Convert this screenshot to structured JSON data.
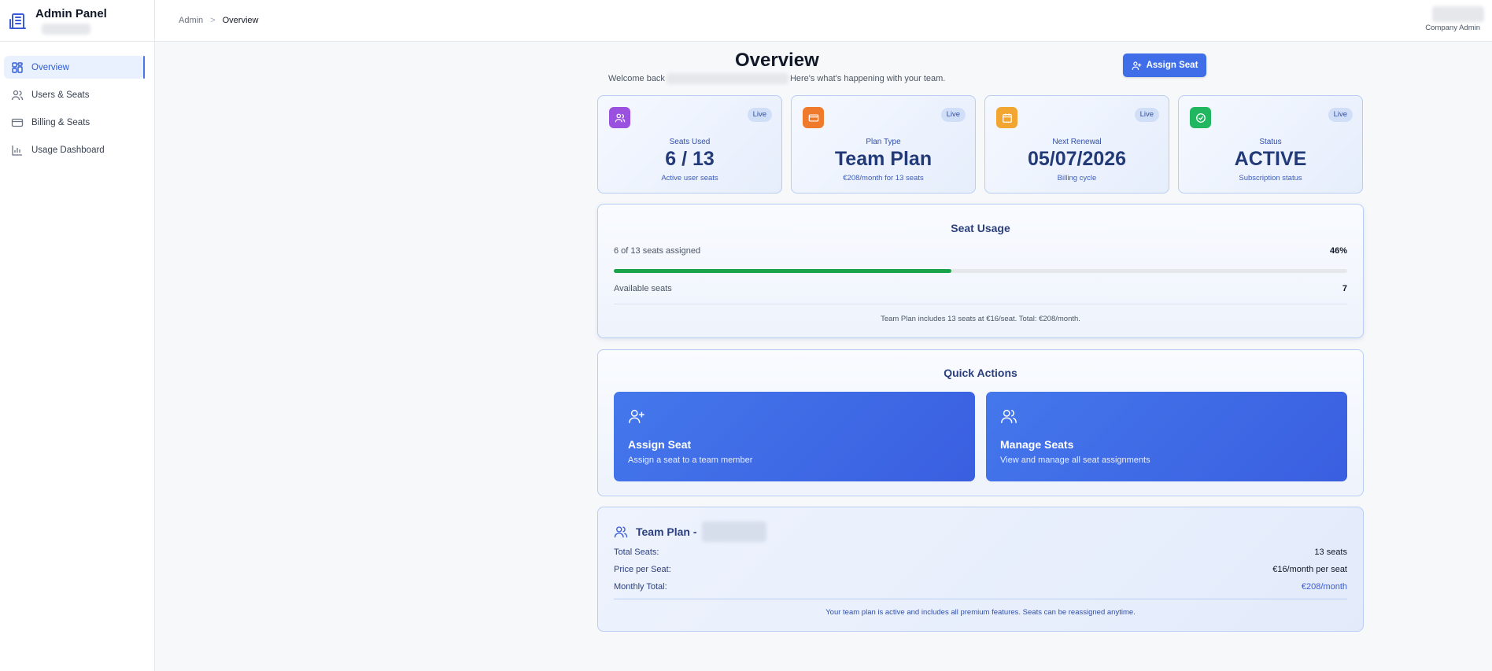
{
  "sidebar": {
    "title": "Admin Panel",
    "items": [
      {
        "label": "Overview",
        "icon": "grid-icon",
        "active": true
      },
      {
        "label": "Users & Seats",
        "icon": "users-icon",
        "active": false
      },
      {
        "label": "Billing & Seats",
        "icon": "credit-card-icon",
        "active": false
      },
      {
        "label": "Usage Dashboard",
        "icon": "bar-chart-icon",
        "active": false
      }
    ]
  },
  "topbar": {
    "breadcrumb": {
      "root": "Admin",
      "separator": ">",
      "current": "Overview"
    },
    "user_role": "Company Admin"
  },
  "header": {
    "title": "Overview",
    "welcome_prefix": "Welcome back",
    "welcome_suffix": "Here's what's happening with your team.",
    "assign_button": "Assign Seat"
  },
  "stats": [
    {
      "label": "Seats Used",
      "value": "6 / 13",
      "sub": "Active user seats",
      "badge": "Live",
      "icon": "users-icon",
      "color": "#9b51e0"
    },
    {
      "label": "Plan Type",
      "value": "Team Plan",
      "sub": "€208/month for 13 seats",
      "badge": "Live",
      "icon": "credit-card-icon",
      "color": "#f07a2b"
    },
    {
      "label": "Next Renewal",
      "value": "05/07/2026",
      "sub": "Billing cycle",
      "badge": "Live",
      "icon": "calendar-icon",
      "color": "#f2a531"
    },
    {
      "label": "Status",
      "value": "ACTIVE",
      "sub": "Subscription status",
      "badge": "Live",
      "icon": "check-circle-icon",
      "color": "#21b660"
    }
  ],
  "seat_usage": {
    "title": "Seat Usage",
    "assigned_text": "6 of 13 seats assigned",
    "percent_text": "46%",
    "percent": 46,
    "available_label": "Available seats",
    "available_value": "7",
    "note": "Team Plan includes 13 seats at €16/seat. Total: €208/month."
  },
  "quick_actions": {
    "title": "Quick Actions",
    "items": [
      {
        "title": "Assign Seat",
        "desc": "Assign a seat to a team member",
        "icon": "user-plus-icon"
      },
      {
        "title": "Manage Seats",
        "desc": "View and manage all seat assignments",
        "icon": "users-icon"
      }
    ]
  },
  "plan": {
    "title": "Team Plan -",
    "rows": [
      {
        "key": "Total Seats:",
        "value": "13 seats"
      },
      {
        "key": "Price per Seat:",
        "value": "€16/month per seat"
      },
      {
        "key": "Monthly Total:",
        "value": "€208/month"
      }
    ],
    "note": "Your team plan is active and includes all premium features. Seats can be reassigned anytime."
  }
}
